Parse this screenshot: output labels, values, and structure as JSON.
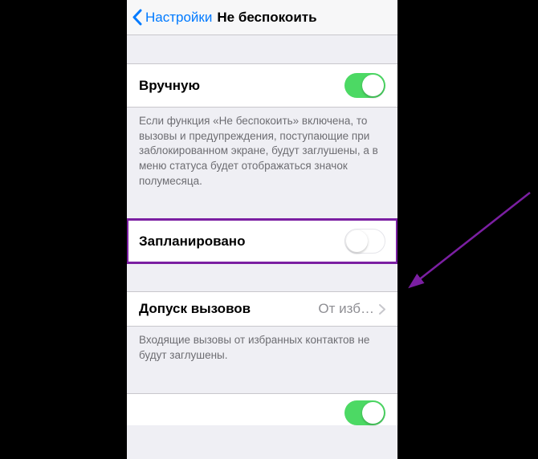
{
  "nav": {
    "back_label": "Настройки",
    "title": "Не беспокоить"
  },
  "sections": {
    "manual": {
      "label": "Вручную",
      "on": true,
      "footer": "Если функция «Не беспокоить» включена, то вызовы и предупреждения, поступающие при заблокированном экране, будут заглушены, а в меню статуса будет отображаться значок полумесяца."
    },
    "scheduled": {
      "label": "Запланировано",
      "on": false
    },
    "allow_calls": {
      "label": "Допуск вызовов",
      "value": "От изб…",
      "footer": "Входящие вызовы от избранных контактов не будут заглушены."
    }
  },
  "colors": {
    "accent": "#007aff",
    "switch_on": "#4cd964",
    "highlight": "#7b1fa2"
  }
}
